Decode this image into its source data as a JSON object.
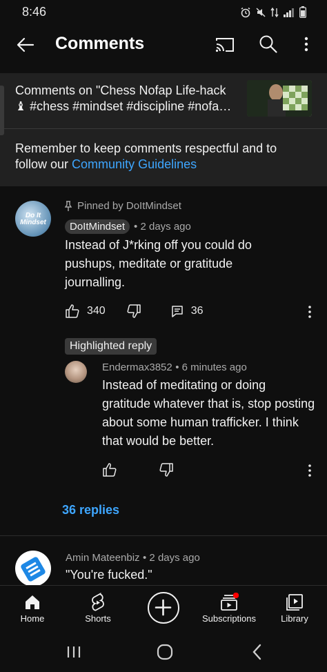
{
  "status": {
    "time": "8:46"
  },
  "app_bar": {
    "title": "Comments"
  },
  "video": {
    "line1": "Comments on \"Chess Nofap Life-hack",
    "line2": "♝ #chess #mindset #discipline #nofa…",
    "guidelines_prefix": "Remember to keep comments respectful and to follow our ",
    "guidelines_link": "Community Guidelines"
  },
  "comments": [
    {
      "pinned_label": "Pinned by DoItMindset",
      "avatar_text": "Do It Mindset",
      "author": "DoItMindset",
      "time": "• 2 days ago",
      "text": "Instead of J*rking off you could do pushups, meditate or gratitude journalling.",
      "likes": "340",
      "replies_count": "36"
    }
  ],
  "highlighted_reply": {
    "chip": "Highlighted reply",
    "author": "Endermax3852",
    "time": "• 6 minutes ago",
    "text": "Instead of meditating or doing gratitude whatever that is, stop posting about some human trafficker. I think that would be better."
  },
  "replies_link": "36 replies",
  "second_comment": {
    "author": "Amin Mateenbiz",
    "time": "• 2 days ago",
    "text": "\"You're fucked.\""
  },
  "bottom_nav": [
    {
      "label": "Home",
      "icon": "home-icon"
    },
    {
      "label": "Shorts",
      "icon": "shorts-icon"
    },
    {
      "label": "",
      "icon": "create-icon"
    },
    {
      "label": "Subscriptions",
      "icon": "subscriptions-icon"
    },
    {
      "label": "Library",
      "icon": "library-icon"
    }
  ],
  "colors": {
    "background": "#0f0f0f",
    "header_bg": "#212121",
    "link": "#3ea6ff",
    "notification_dot": "#ff0000"
  }
}
